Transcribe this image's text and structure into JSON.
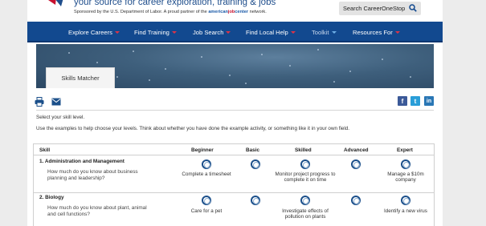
{
  "header": {
    "tagline": "your source for career exploration, training & jobs",
    "sponsor_prefix": "Sponsored by the U.S. Department of Labor. A proud partner of the",
    "partner_name_1": "american",
    "partner_name_2": "job",
    "partner_name_3": "center",
    "sponsor_suffix": "network.",
    "search_label": "Search CareerOneStop"
  },
  "nav": {
    "items": [
      {
        "label": "Explore Careers"
      },
      {
        "label": "Find Training"
      },
      {
        "label": "Job Search"
      },
      {
        "label": "Find Local Help"
      },
      {
        "label": "Toolkit"
      },
      {
        "label": "Resources For"
      }
    ]
  },
  "banner": {
    "tab_label": "Skills Matcher"
  },
  "intro": {
    "line1": "Select your skill level.",
    "line2": "Use the examples to help choose your levels. Think about whether you have done the example activity, or something like it in your own field."
  },
  "social": {
    "facebook": "f",
    "twitter": "t",
    "linkedin": "in"
  },
  "colors": {
    "nav_bg": "#12498f",
    "accent_red": "#e03345",
    "radio_border": "#1b4f8a"
  },
  "table": {
    "headers": {
      "skill": "Skill",
      "beginner": "Beginner",
      "basic": "Basic",
      "skilled": "Skilled",
      "advanced": "Advanced",
      "expert": "Expert"
    },
    "rows": [
      {
        "title": "1. Administration and Management",
        "question": "How much do you know about business planning and leadership?",
        "beginner_example": "Complete a timesheet",
        "skilled_example": "Monitor project progress to complete it on time",
        "expert_example": "Manage a $10m company"
      },
      {
        "title": "2. Biology",
        "question": "How much do you know about plant, animal and cell functions?",
        "beginner_example": "Care for a pet",
        "skilled_example": "Investigate effects of pollution on plants",
        "expert_example": "Identify a new virus"
      }
    ]
  }
}
